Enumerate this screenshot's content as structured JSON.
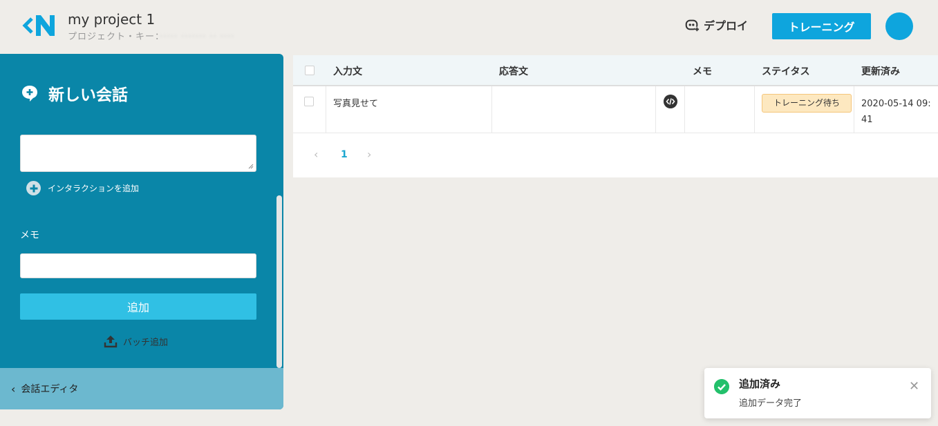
{
  "header": {
    "project_name": "my project 1",
    "project_key_label": "プロジェクト・キー：",
    "project_key_masked": "····· ······· ·· ····",
    "deploy_label": "デプロイ",
    "train_label": "トレーニング"
  },
  "sidebar": {
    "title": "新しい会話",
    "add_interaction_label": "インタラクションを追加",
    "memo_label": "メモ",
    "memo_value": "",
    "input_value": "",
    "add_button_label": "追加",
    "batch_label": "バッチ追加",
    "footer_label": "会話エディタ"
  },
  "table": {
    "columns": [
      "入力文",
      "応答文",
      "メモ",
      "ステイタス",
      "更新済み"
    ],
    "rows": [
      {
        "input": "写真見せて",
        "response": "",
        "memo": "",
        "status": "トレーニング待ち",
        "updated": "2020-05-14 09:41"
      }
    ],
    "pagination": {
      "current_page": "1"
    }
  },
  "toast": {
    "title": "追加済み",
    "message": "追加データ完了"
  },
  "colors": {
    "accent": "#0ea5dd",
    "sidebar": "#0a86a8",
    "sidebar_footer": "#6cb8cf",
    "add_button": "#30c0e4",
    "status_badge": "#fde8c0",
    "success": "#23c06b"
  },
  "icons": {
    "logo": "logo-icon",
    "deploy": "bot-icon",
    "new_conversation": "chat-plus-icon",
    "add_interaction": "plus-circle-icon",
    "batch": "upload-icon",
    "footer": "chevron-left-icon",
    "code": "code-icon",
    "toast": "check-circle-icon",
    "close": "close-icon"
  }
}
